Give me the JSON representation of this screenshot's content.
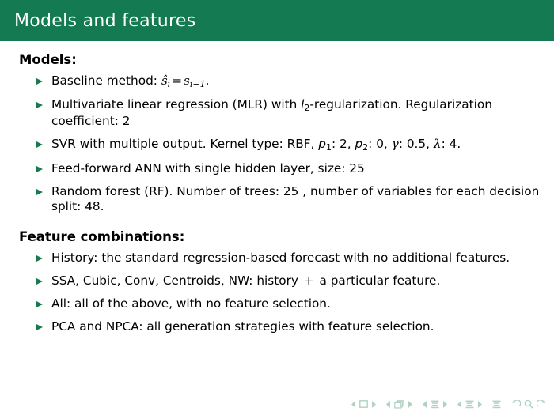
{
  "slide": {
    "title": "Models and features",
    "theme": {
      "header_bg": "#137a52",
      "header_fg": "#ffffff",
      "bullet_color": "#1a7a4e",
      "body_fg": "#000000",
      "nav_color": "#a9cdbb"
    }
  },
  "sections": [
    {
      "heading": "Models:",
      "items": [
        {
          "id": "baseline",
          "parts": [
            {
              "type": "text",
              "value": "Baseline method: "
            },
            {
              "type": "math",
              "value": "ŝ"
            },
            {
              "type": "sub",
              "value": "i"
            },
            {
              "type": "op",
              "value": "="
            },
            {
              "type": "math",
              "value": "s"
            },
            {
              "type": "sub",
              "value": "i−1"
            },
            {
              "type": "text",
              "value": "."
            }
          ],
          "plain": "Baseline method: ŝᵢ = sᵢ₋₁."
        },
        {
          "id": "mlr",
          "parts": [
            {
              "type": "text",
              "value": "Multivariate linear regression (MLR) with "
            },
            {
              "type": "math-sans",
              "value": "l"
            },
            {
              "type": "sub-upright",
              "value": "2"
            },
            {
              "type": "text",
              "value": "-regularization. Regularization coefficient: 2"
            }
          ],
          "plain": "Multivariate linear regression (MLR) with l2-regularization. Regularization coefficient: 2"
        },
        {
          "id": "svr",
          "parts": [
            {
              "type": "text",
              "value": "SVR with multiple output. Kernel type: RBF, "
            },
            {
              "type": "math-sans",
              "value": "p"
            },
            {
              "type": "sub-upright",
              "value": "1"
            },
            {
              "type": "text",
              "value": ": 2, "
            },
            {
              "type": "math-sans",
              "value": "p"
            },
            {
              "type": "sub-upright",
              "value": "2"
            },
            {
              "type": "text",
              "value": ": 0, "
            },
            {
              "type": "math",
              "value": "γ"
            },
            {
              "type": "text",
              "value": ": 0.5, "
            },
            {
              "type": "math",
              "value": "λ"
            },
            {
              "type": "text",
              "value": ": 4."
            }
          ],
          "plain": "SVR with multiple output. Kernel type: RBF, p1: 2, p2: 0, γ: 0.5, λ: 4."
        },
        {
          "id": "ann",
          "parts": [
            {
              "type": "text",
              "value": "Feed-forward ANN with single hidden layer, size: 25"
            }
          ],
          "plain": "Feed-forward ANN with single hidden layer, size: 25"
        },
        {
          "id": "rf",
          "parts": [
            {
              "type": "text",
              "value": "Random forest (RF). Number of trees: 25 , number of variables for each decision split: 48."
            }
          ],
          "plain": "Random forest (RF). Number of trees: 25 , number of variables for each decision split: 48."
        }
      ]
    },
    {
      "heading": "Feature combinations:",
      "items": [
        {
          "id": "history",
          "parts": [
            {
              "type": "text",
              "value": "History: the standard regression-based forecast with no additional features."
            }
          ],
          "plain": "History: the standard regression-based forecast with no additional features."
        },
        {
          "id": "single-feature",
          "parts": [
            {
              "type": "text",
              "value": "SSA, Cubic, Conv, Centroids, NW: history "
            },
            {
              "type": "op",
              "value": "+"
            },
            {
              "type": "text",
              "value": " a particular feature."
            }
          ],
          "plain": "SSA, Cubic, Conv, Centroids, NW: history + a particular feature."
        },
        {
          "id": "all",
          "parts": [
            {
              "type": "text",
              "value": "All: all of the above, with no feature selection."
            }
          ],
          "plain": "All: all of the above, with no feature selection."
        },
        {
          "id": "pca",
          "parts": [
            {
              "type": "text",
              "value": "PCA and NPCA: all generation strategies with feature selection."
            }
          ],
          "plain": "PCA and NPCA: all generation strategies with feature selection."
        }
      ]
    }
  ],
  "navigation": {
    "groups": [
      {
        "id": "slide",
        "icon": "slide-icon",
        "label": "Slide"
      },
      {
        "id": "frame",
        "icon": "frame-icon",
        "label": "Frame"
      },
      {
        "id": "subsection",
        "icon": "subsection-icon",
        "label": "Subsection"
      },
      {
        "id": "section",
        "icon": "section-icon",
        "label": "Section"
      },
      {
        "id": "presentation",
        "icon": "presentation-icon",
        "label": "Presentation"
      },
      {
        "id": "appendix",
        "icon": "appendix-icon",
        "label": "Back / Find / Forward"
      }
    ]
  }
}
